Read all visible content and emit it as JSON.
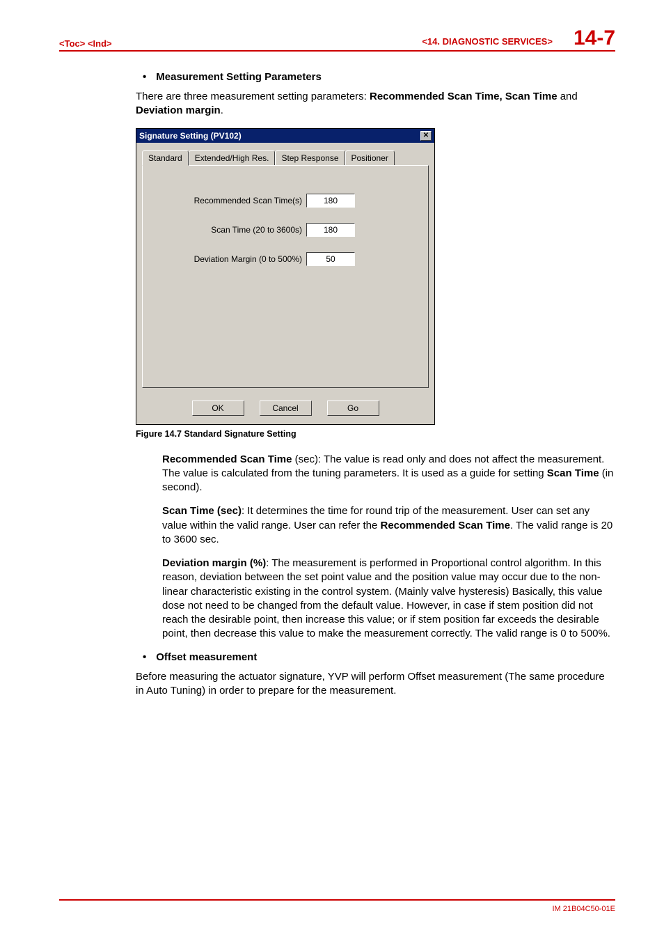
{
  "header": {
    "toc": "<Toc>",
    "ind": "<Ind>",
    "section": "<14.  DIAGNOSTIC SERVICES>",
    "page": "14-7"
  },
  "bullet1_label": "Measurement Setting Parameters",
  "intro_a": "There are three measurement setting parameters: ",
  "intro_b": "Recommended Scan Time, Scan Time",
  "intro_c": " and ",
  "intro_d": "Deviation margin",
  "intro_e": ".",
  "dialog": {
    "title": "Signature Setting (PV102)",
    "tabs": {
      "t1": "Standard",
      "t2": "Extended/High Res.",
      "t3": "Step Response",
      "t4": "Positioner"
    },
    "fields": {
      "rec_label": "Recommended Scan Time(s)",
      "rec_value": "180",
      "scan_label": "Scan Time (20 to 3600s)",
      "scan_value": "180",
      "dev_label": "Deviation Margin (0 to 500%)",
      "dev_value": "50"
    },
    "buttons": {
      "ok": "OK",
      "cancel": "Cancel",
      "go": "Go"
    }
  },
  "caption": "Figure 14.7  Standard Signature Setting",
  "p1": {
    "a": "Recommended Scan Time",
    "b": " (sec):  The value is read only and does not affect the measurement. The value is calculated from the tuning parameters. It is used as a guide for setting ",
    "c": "Scan Time",
    "d": " (in second)."
  },
  "p2": {
    "a": "Scan Time (sec)",
    "b": ": It determines the time for round trip of the measurement. User can set any value within the valid range. User can refer the ",
    "c": "Recommended Scan Time",
    "d": ". The valid range is 20 to 3600 sec."
  },
  "p3": {
    "a": "Deviation margin (%)",
    "b": ": The measurement is performed in Proportional control algorithm. In this reason, deviation between the set point value and the position value may occur due to the non-linear characteristic existing in the control system. (Mainly valve hysteresis) Basically, this value dose not need to be changed from the default value. However, in case if stem position did not reach the desirable point, then increase this value; or if stem position far exceeds the desirable point, then decrease this value to make the measurement correctly. The valid range is 0 to 500%."
  },
  "bullet2_label": "Offset measurement",
  "p4": "Before measuring the actuator signature, YVP will perform Offset measurement (The same procedure in Auto Tuning) in order to prepare for the measurement.",
  "footer": "IM 21B04C50-01E"
}
